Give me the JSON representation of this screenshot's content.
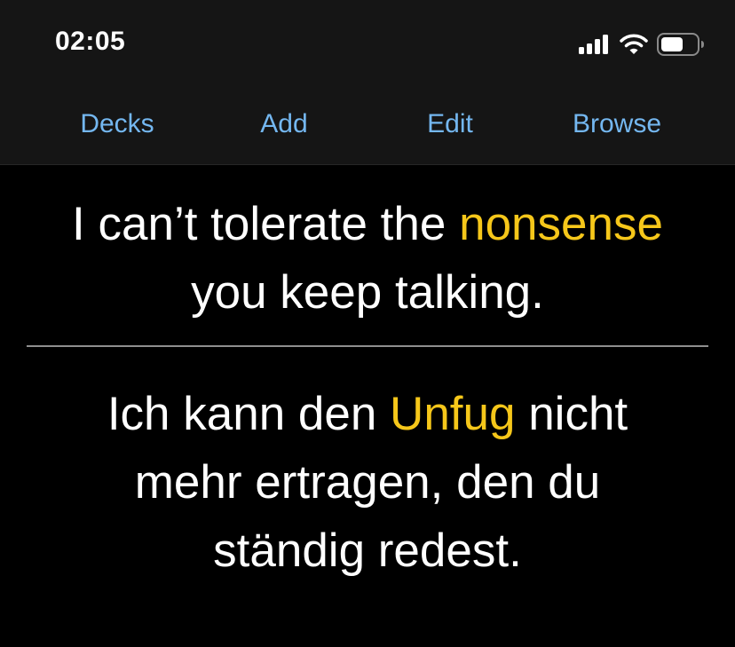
{
  "status_bar": {
    "time": "02:05",
    "icons": [
      "cellular-signal-icon",
      "wifi-icon",
      "battery-icon"
    ]
  },
  "nav": {
    "items": [
      {
        "label": "Decks"
      },
      {
        "label": "Add"
      },
      {
        "label": "Edit"
      },
      {
        "label": "Browse"
      }
    ]
  },
  "card": {
    "front": {
      "line1_pre": "I can’t tolerate the ",
      "line1_highlight": "nonsense",
      "line2": "you keep talking."
    },
    "back": {
      "line1_pre": "Ich kann den ",
      "line1_highlight": "Unfug",
      "line1_post": " nicht",
      "line2": "mehr ertragen, den du",
      "line3": "ständig redest."
    }
  },
  "colors": {
    "accent": "#74b7f0",
    "highlight": "#f6c71a",
    "topbar_background": "#151515",
    "card_background": "#000000",
    "text": "#ffffff"
  }
}
